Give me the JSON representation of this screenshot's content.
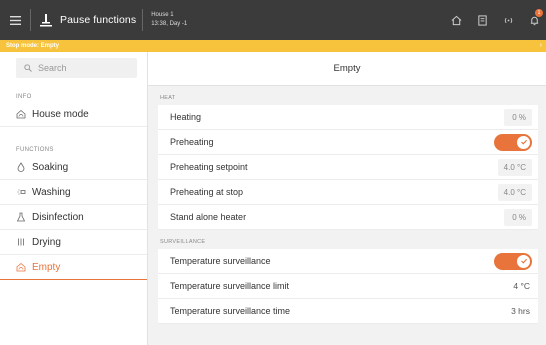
{
  "header": {
    "title": "Pause functions",
    "house_name": "House 1",
    "house_time": "13:38, Day -1",
    "notification_count": "1"
  },
  "banner": {
    "text": "Stop mode: Empty",
    "color": "#f7c33c"
  },
  "colors": {
    "accent": "#e8743b",
    "topbar": "#3b3b3b"
  },
  "sidebar": {
    "search_placeholder": "Search",
    "info_label": "INFO",
    "functions_label": "FUNCTIONS",
    "info_items": [
      {
        "label": "House mode",
        "icon": "house-icon"
      }
    ],
    "function_items": [
      {
        "label": "Soaking",
        "icon": "drop-icon"
      },
      {
        "label": "Washing",
        "icon": "spray-icon"
      },
      {
        "label": "Disinfection",
        "icon": "flask-icon"
      },
      {
        "label": "Drying",
        "icon": "heat-icon"
      },
      {
        "label": "Empty",
        "icon": "empty-house-icon",
        "active": true
      }
    ]
  },
  "main": {
    "title": "Empty",
    "heat": {
      "label": "HEAT",
      "rows": [
        {
          "label": "Heating",
          "value": "0 %"
        },
        {
          "label": "Preheating",
          "toggle": true
        },
        {
          "label": "Preheating setpoint",
          "value": "4.0 °C"
        },
        {
          "label": "Preheating at stop",
          "value": "4.0 °C"
        },
        {
          "label": "Stand alone heater",
          "value": "0 %"
        }
      ]
    },
    "surveillance": {
      "label": "SURVEILLANCE",
      "rows": [
        {
          "label": "Temperature surveillance",
          "toggle": true
        },
        {
          "label": "Temperature surveillance limit",
          "value": "4 °C"
        },
        {
          "label": "Temperature surveillance time",
          "value": "3 hrs"
        }
      ]
    }
  }
}
